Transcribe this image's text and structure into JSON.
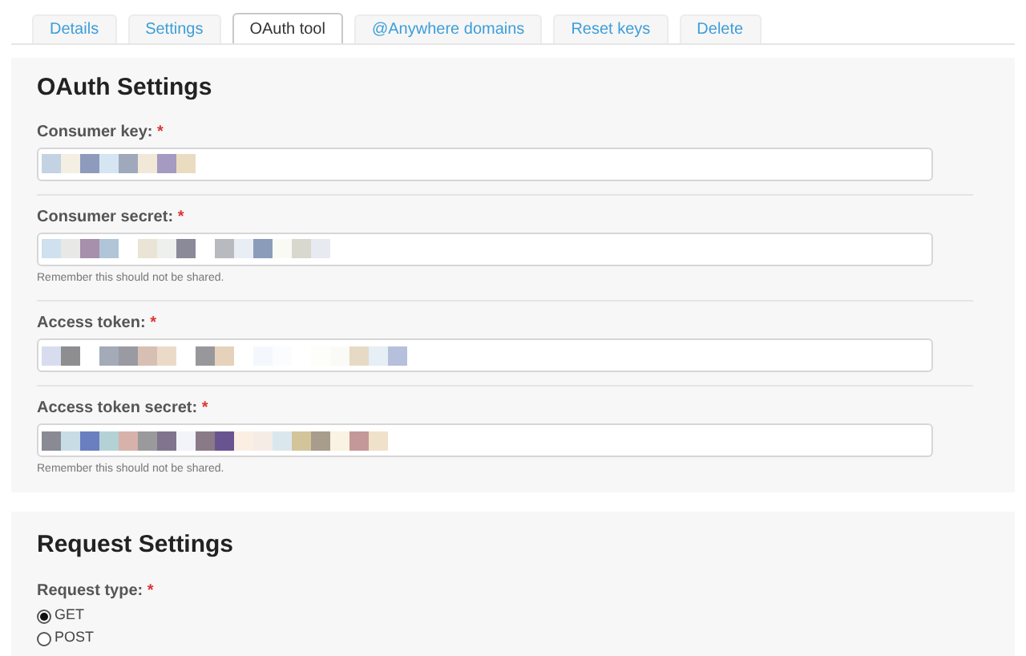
{
  "tabs": [
    {
      "label": "Details",
      "selected": false
    },
    {
      "label": "Settings",
      "selected": false
    },
    {
      "label": "OAuth tool",
      "selected": true
    },
    {
      "label": "@Anywhere domains",
      "selected": false
    },
    {
      "label": "Reset keys",
      "selected": false
    },
    {
      "label": "Delete",
      "selected": false
    }
  ],
  "oauth_settings": {
    "title": "OAuth Settings",
    "fields": [
      {
        "label": "Consumer key:",
        "required": "*"
      },
      {
        "label": "Consumer secret:",
        "required": "*",
        "hint": "Remember this should not be shared."
      },
      {
        "label": "Access token:",
        "required": "*"
      },
      {
        "label": "Access token secret:",
        "required": "*",
        "hint": "Remember this should not be shared."
      }
    ]
  },
  "request_settings": {
    "title": "Request Settings",
    "request_type": {
      "label": "Request type:",
      "required": "*",
      "options": [
        {
          "label": "GET",
          "selected": true
        },
        {
          "label": "POST",
          "selected": false
        }
      ]
    }
  }
}
